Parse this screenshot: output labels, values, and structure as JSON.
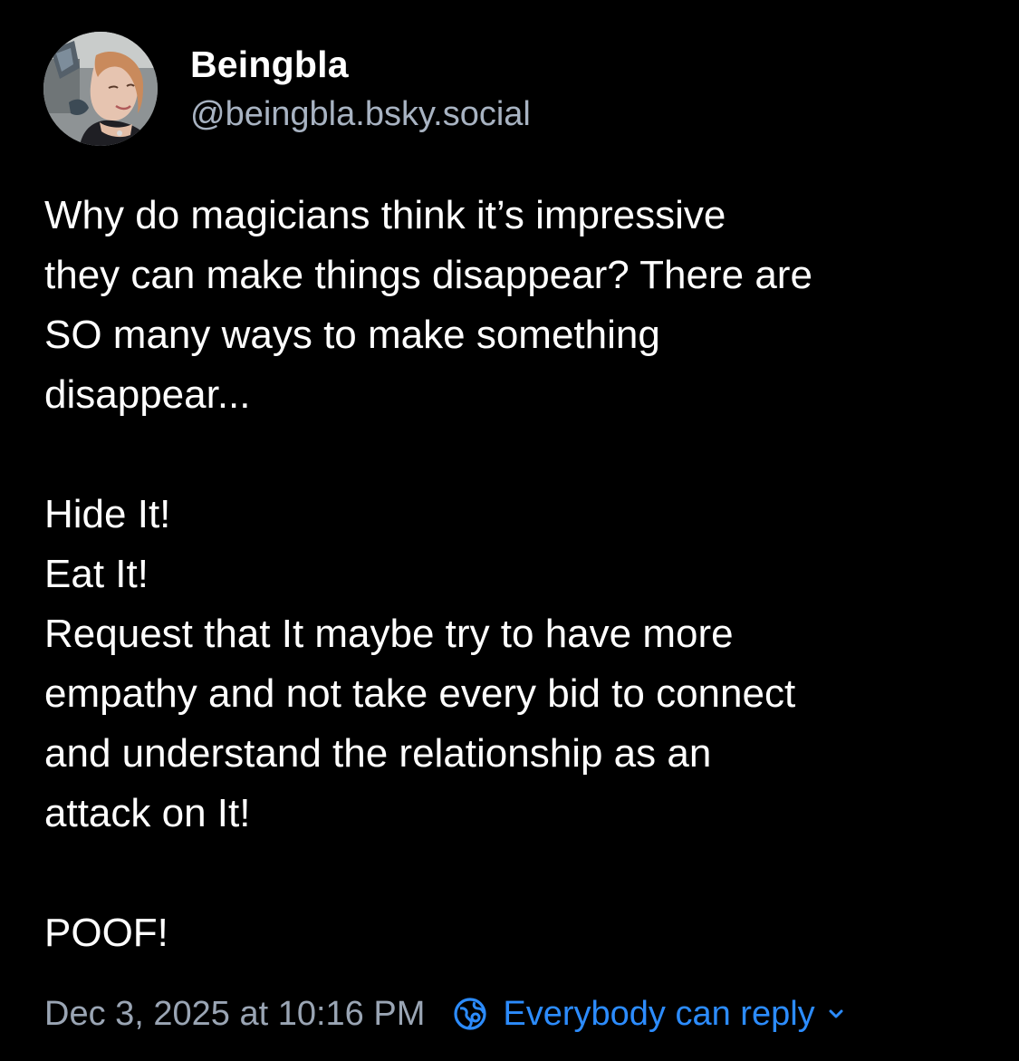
{
  "author": {
    "display_name": "Beingbla",
    "handle": "@beingbla.bsky.social",
    "avatar_icon": "user-avatar-photo"
  },
  "post": {
    "paragraphs": [
      [
        "Why do magicians think it’s impressive",
        "they can make things disappear? There are",
        "SO many ways to make something",
        "disappear..."
      ],
      [
        "Hide It!",
        "Eat It!",
        "Request that It maybe try to have more",
        "empathy and not take every bid to connect",
        "and understand the relationship as an",
        "attack on It!"
      ],
      [
        "POOF!"
      ]
    ]
  },
  "footer": {
    "timestamp": "Dec 3, 2025 at 10:16 PM",
    "reply_setting_label": "Everybody can reply",
    "reply_icon": "globe-icon",
    "dropdown_icon": "chevron-down-icon"
  },
  "colors": {
    "background": "#000000",
    "text": "#ffffff",
    "muted": "#9aa5b4",
    "accent": "#2c8cff"
  }
}
